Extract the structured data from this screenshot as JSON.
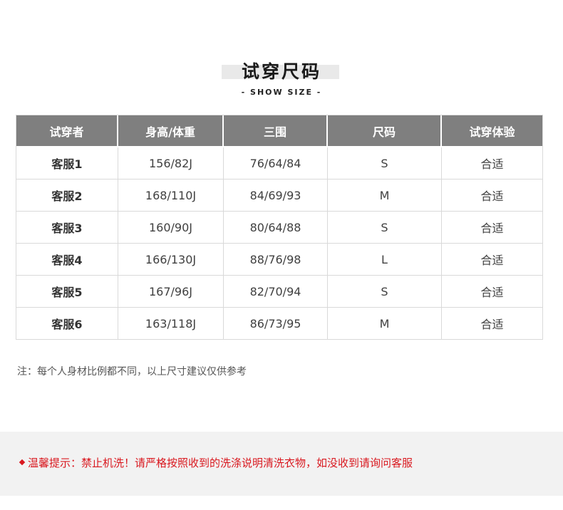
{
  "header": {
    "title": "试穿尺码",
    "subtitle": "- SHOW SIZE -"
  },
  "table": {
    "columns": [
      "试穿者",
      "身高/体重",
      "三围",
      "尺码",
      "试穿体验"
    ],
    "rows": [
      [
        "客服1",
        "156/82J",
        "76/64/84",
        "S",
        "合适"
      ],
      [
        "客服2",
        "168/110J",
        "84/69/93",
        "M",
        "合适"
      ],
      [
        "客服3",
        "160/90J",
        "80/64/88",
        "S",
        "合适"
      ],
      [
        "客服4",
        "166/130J",
        "88/76/98",
        "L",
        "合适"
      ],
      [
        "客服5",
        "167/96J",
        "82/70/94",
        "S",
        "合适"
      ],
      [
        "客服6",
        "163/118J",
        "86/73/95",
        "M",
        "合适"
      ]
    ]
  },
  "note": "注：每个人身材比例都不同，以上尺寸建议仅供参考",
  "warning": {
    "icon": "diamond-icon",
    "text": "温馨提示：禁止机洗！请严格按照收到的洗涤说明清洗衣物，如没收到请询问客服"
  },
  "colors": {
    "header_bg": "#7f7f7f",
    "warning_red": "#d9181f",
    "band_gray": "#f2f2f2"
  }
}
